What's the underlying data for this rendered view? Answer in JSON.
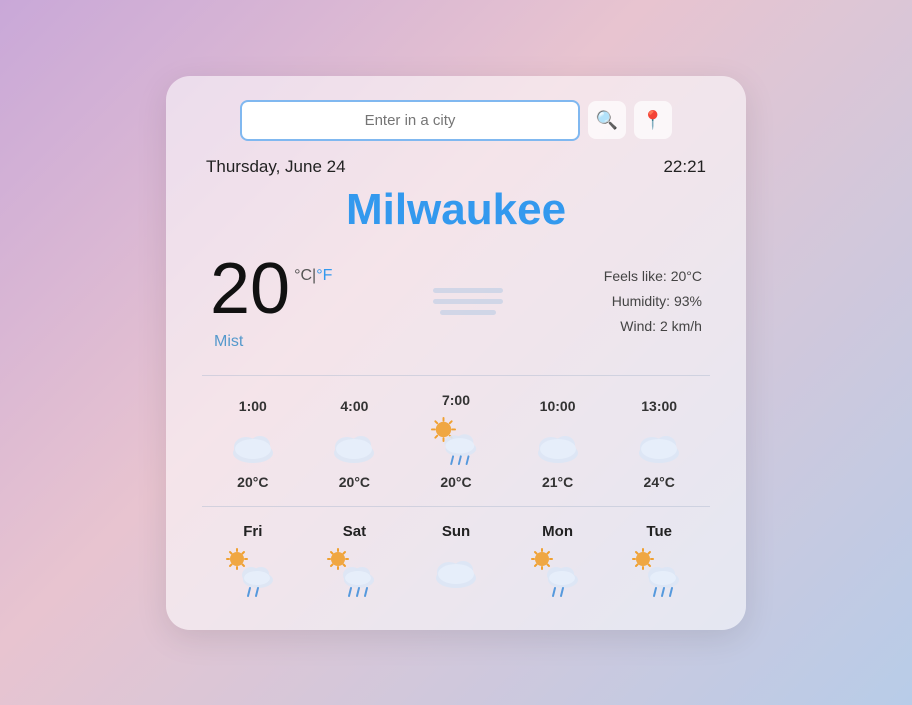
{
  "search": {
    "placeholder": "Enter in a city",
    "value": ""
  },
  "datetime": {
    "date": "Thursday, June 24",
    "time": "22:21"
  },
  "city": "Milwaukee",
  "current": {
    "temp": "20",
    "unit_c": "°C",
    "separator": "|",
    "unit_f": "°F",
    "description": "Mist",
    "feels_like": "Feels like: 20°C",
    "humidity": "Humidity: 93%",
    "wind": "Wind: 2 km/h"
  },
  "hourly": [
    {
      "time": "1:00",
      "temp": "20°C",
      "icon": "cloud"
    },
    {
      "time": "4:00",
      "temp": "20°C",
      "icon": "cloud"
    },
    {
      "time": "7:00",
      "temp": "20°C",
      "icon": "sun-rain"
    },
    {
      "time": "10:00",
      "temp": "21°C",
      "icon": "cloud"
    },
    {
      "time": "13:00",
      "temp": "24°C",
      "icon": "cloud"
    }
  ],
  "daily": [
    {
      "day": "Fri",
      "icon": "sun-rain"
    },
    {
      "day": "Sat",
      "icon": "sun-rain"
    },
    {
      "day": "Sun",
      "icon": "cloud"
    },
    {
      "day": "Mon",
      "icon": "sun-rain"
    },
    {
      "day": "Tue",
      "icon": "sun-rain"
    }
  ],
  "icons": {
    "search": "🔍",
    "pin": "📍"
  }
}
